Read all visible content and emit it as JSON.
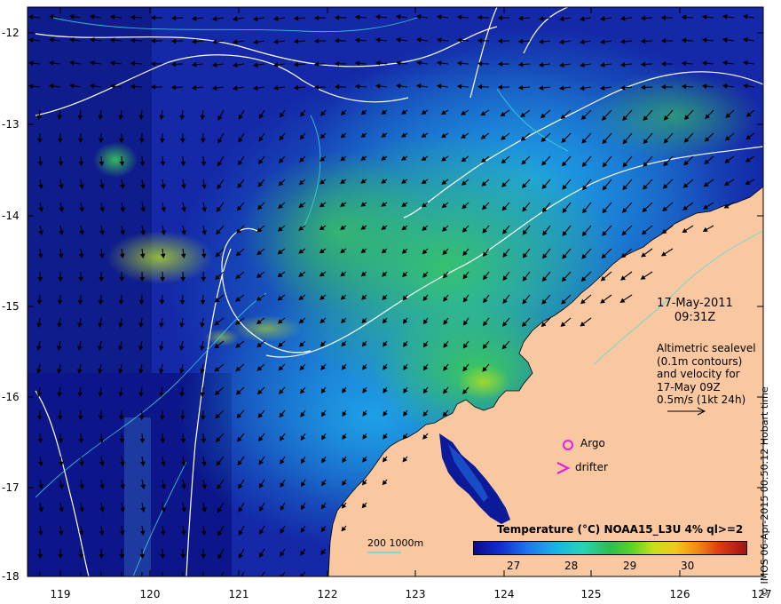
{
  "map": {
    "y_axis_labels": [
      "-12",
      "-13",
      "-14",
      "-15",
      "-16",
      "-17",
      "-18"
    ],
    "x_axis_labels": [
      "119",
      "120",
      "121",
      "122",
      "123",
      "124",
      "125",
      "126",
      "127"
    ],
    "date": "17-May-2011",
    "time": "09:31Z",
    "altimetry_lines": [
      "Altimetric sealevel",
      "(0.1m contours)",
      "and velocity for",
      "17-May 09Z",
      "0.5m/s (1kt 24h)"
    ],
    "argo_label": "Argo",
    "drifter_label": "drifter",
    "drifter_symbol": ">",
    "depth_legend": "200  1000m",
    "colorbar_title": "Temperature (°C) NOAA15_L3U 4% ql>=2",
    "colorbar_ticks": [
      "27",
      "28",
      "29",
      "30"
    ],
    "credit": "© IMOS 06-Apr-2015 00:50:12 Hobart time",
    "colors": {
      "land": "#f9c8a0",
      "deep_ocean": "#10188c",
      "argo_marker": "#e020e0",
      "contour": "#ffffff",
      "bathy_contour": "#40e0e0"
    },
    "icons": [
      "argo-circle-icon",
      "drifter-chevron-icon",
      "velocity-scale-arrow-icon"
    ]
  }
}
